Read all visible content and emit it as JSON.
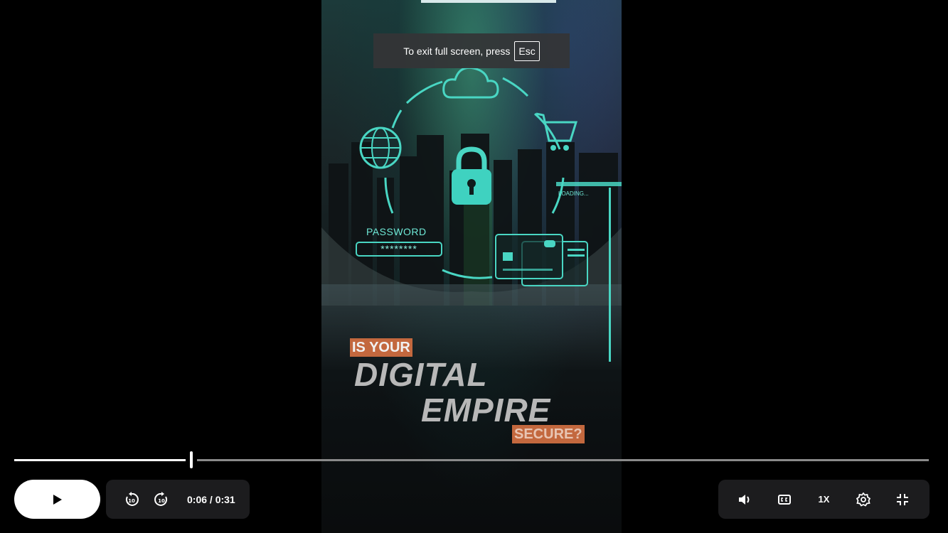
{
  "fullscreen_hint": {
    "text": "To exit full screen, press",
    "key": "Esc"
  },
  "video": {
    "overlay": {
      "password_label": "PASSWORD",
      "password_mask": "********",
      "loading_label": "LOADING...",
      "tag_top": "IS YOUR",
      "word_1": "DIGITAL",
      "word_2": "EMPIRE",
      "tag_bottom": "SECURE?"
    }
  },
  "player": {
    "progress_fraction": 0.194,
    "current_time": "0:06",
    "duration": "0:31",
    "time_display": "0:06 / 0:31",
    "speed": "1X",
    "icons": {
      "play": "play-icon",
      "rewind": "rewind-10-icon",
      "forward": "forward-10-icon",
      "volume": "volume-icon",
      "captions": "captions-icon",
      "settings": "gear-icon",
      "exit_fullscreen": "exit-fullscreen-icon"
    }
  }
}
